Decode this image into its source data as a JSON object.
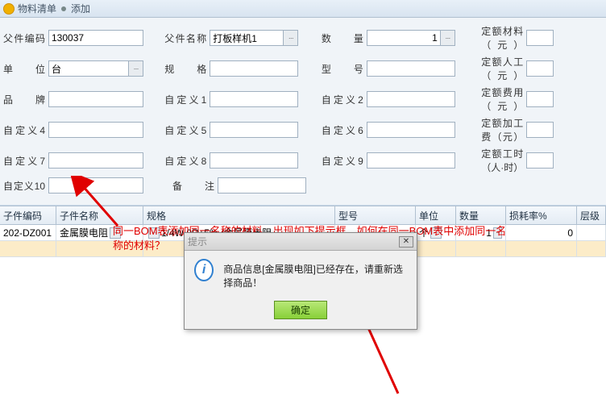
{
  "titlebar": {
    "title": "物料清单",
    "mode": "添加"
  },
  "form": {
    "labels": {
      "parent_code": "父件编码",
      "parent_name": "父件名称",
      "qty": "数　　量",
      "std_material": "定额材料（元）",
      "unit": "单　　位",
      "spec": "规　　格",
      "model": "型　　号",
      "std_labor": "定额人工（元）",
      "brand": "品牌",
      "c1": "自定义1",
      "c2": "自定义2",
      "std_fee": "定额费用（元）",
      "c4": "自定义4",
      "c5": "自定义5",
      "c6": "自定义6",
      "std_proc": "定额加工费（元）",
      "c7": "自定义7",
      "c8": "自定义8",
      "c9": "自定义9",
      "std_hours": "定额工时（人·时）",
      "c10": "自定义10",
      "remark": "备　　注"
    },
    "values": {
      "parent_code": "130037",
      "parent_name": "打板样机1",
      "qty": "1",
      "unit": "台"
    }
  },
  "table": {
    "headers": {
      "code": "子件编码",
      "name": "子件名称",
      "spec": "规格",
      "model": "型号",
      "unit": "单位",
      "qty": "数量",
      "rate": "损耗率%",
      "level": "层级"
    },
    "rows": [
      {
        "code": "202-DZ001",
        "name": "金属膜电阻",
        "spec": "1/4W 0R±5% /金属膜电阻",
        "model": "",
        "unit": "个",
        "qty": "1",
        "rate": "0",
        "level": ""
      }
    ]
  },
  "annotation": "同一BOM表添加同一名称的材料，出现如下提示框，如何在同一BOM表中添加同一名称的材料？",
  "dialog": {
    "title": "提示",
    "message": "商品信息[金属膜电阻]已经存在，请重新选择商品！",
    "ok": "确定"
  },
  "icons": {
    "picker": "···",
    "close": "✕"
  }
}
